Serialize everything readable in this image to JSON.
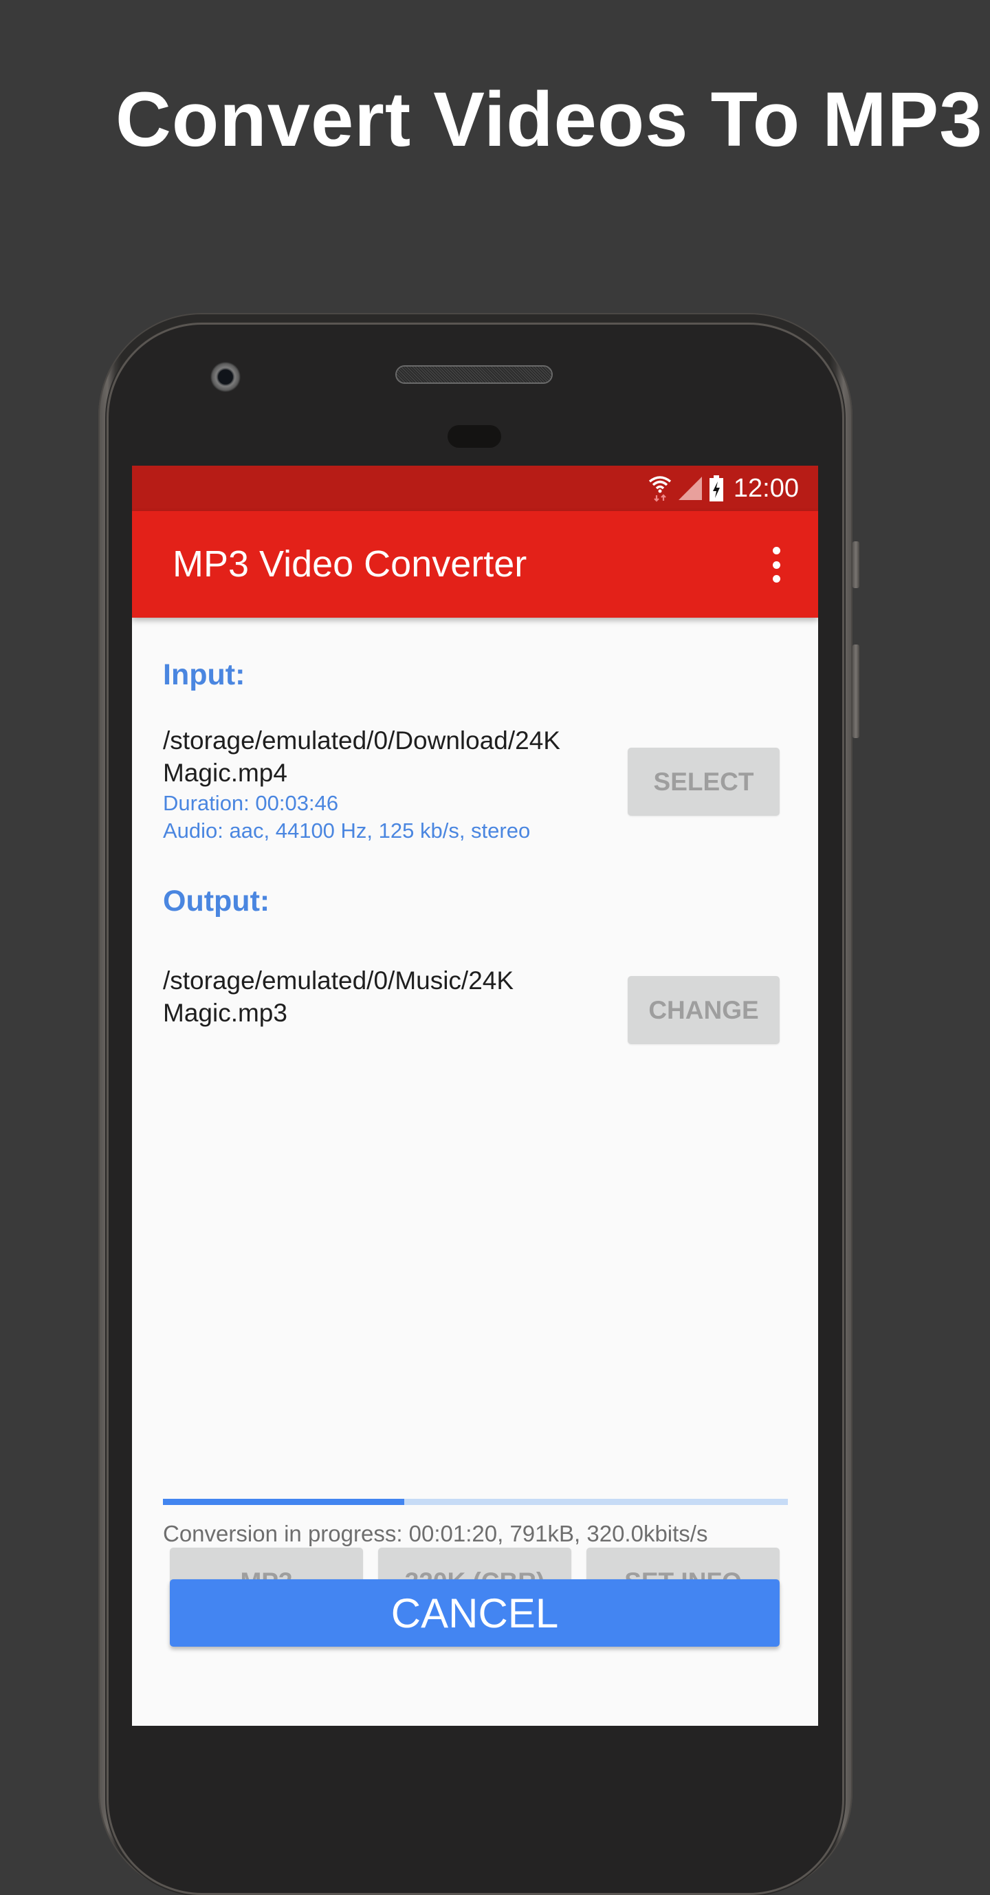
{
  "headline": "Convert Videos To MP3",
  "status_bar": {
    "time": "12:00",
    "icons": [
      "wifi-icon",
      "cell-signal-icon",
      "battery-charging-icon"
    ]
  },
  "app_bar": {
    "title": "MP3 Video Converter",
    "overflow_icon": "more-vert-icon"
  },
  "input": {
    "label": "Input:",
    "path_line1": "/storage/emulated/0/Download/24K",
    "path_line2": "Magic.mp4",
    "duration": "Duration: 00:03:46",
    "audio": "Audio: aac, 44100 Hz, 125 kb/s, stereo",
    "select_label": "SELECT"
  },
  "output": {
    "label": "Output:",
    "path_line1": "/storage/emulated/0/Music/24K",
    "path_line2": "Magic.mp3",
    "change_label": "CHANGE"
  },
  "options": {
    "format_label": "MP3",
    "bitrate_label": "320K (CBR)",
    "set_info_label": "SET INFO"
  },
  "progress": {
    "fraction": 0.386,
    "status_text": "Conversion in progress: 00:01:20, 791kB, 320.0kbits/s"
  },
  "cancel_label": "CANCEL",
  "colors": {
    "status_bar": "#b71c16",
    "app_bar": "#e32119",
    "accent_blue": "#4285f0",
    "label_blue": "#4a86e0",
    "disabled_button": "#d7d8d8"
  }
}
